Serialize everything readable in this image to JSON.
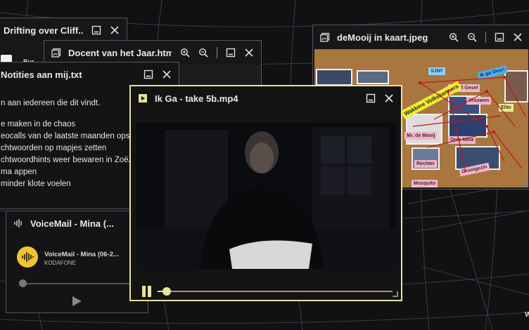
{
  "windows": {
    "drifting": {
      "title": "Drifting over Cliff...",
      "snippet": "Bur"
    },
    "docent": {
      "title": "Docent van het Jaar.html"
    },
    "notes": {
      "title": "Notities aan mij.txt",
      "intro": "n aan iedereen die dit vindt.",
      "lines": [
        "e maken in de chaos",
        "eocalls van de laatste maanden opsp",
        "chtwoorden op mapjes zetten",
        "chtwoordhints weer bewaren in ZoëZ",
        "ma appen",
        "minder klote voelen"
      ]
    },
    "voicemail": {
      "title": "VoiceMail - Mina (...",
      "track_title": "VoiceMail - Mina (06-2...",
      "subtitle": "KODAFONE",
      "progress": 0
    },
    "board": {
      "title": "deMooij in kaart.jpeg",
      "notes": [
        "SJW!",
        "Geert Gesel",
        "Vrouwen",
        "Elite",
        "Wakkere Volkskenners",
        "Ik ga Over!",
        "Mr. de Mooij",
        "Oma Mina",
        "Rechter",
        "Grootgezin",
        "Mosquito"
      ]
    },
    "video": {
      "title": "Ik Ga - take 5b.mp4",
      "progress": 0.04
    }
  },
  "desktop": {
    "corner_text": "W"
  },
  "colors": {
    "accent": "#e7e29a",
    "badge": "#f2c230",
    "background": "#111113"
  }
}
